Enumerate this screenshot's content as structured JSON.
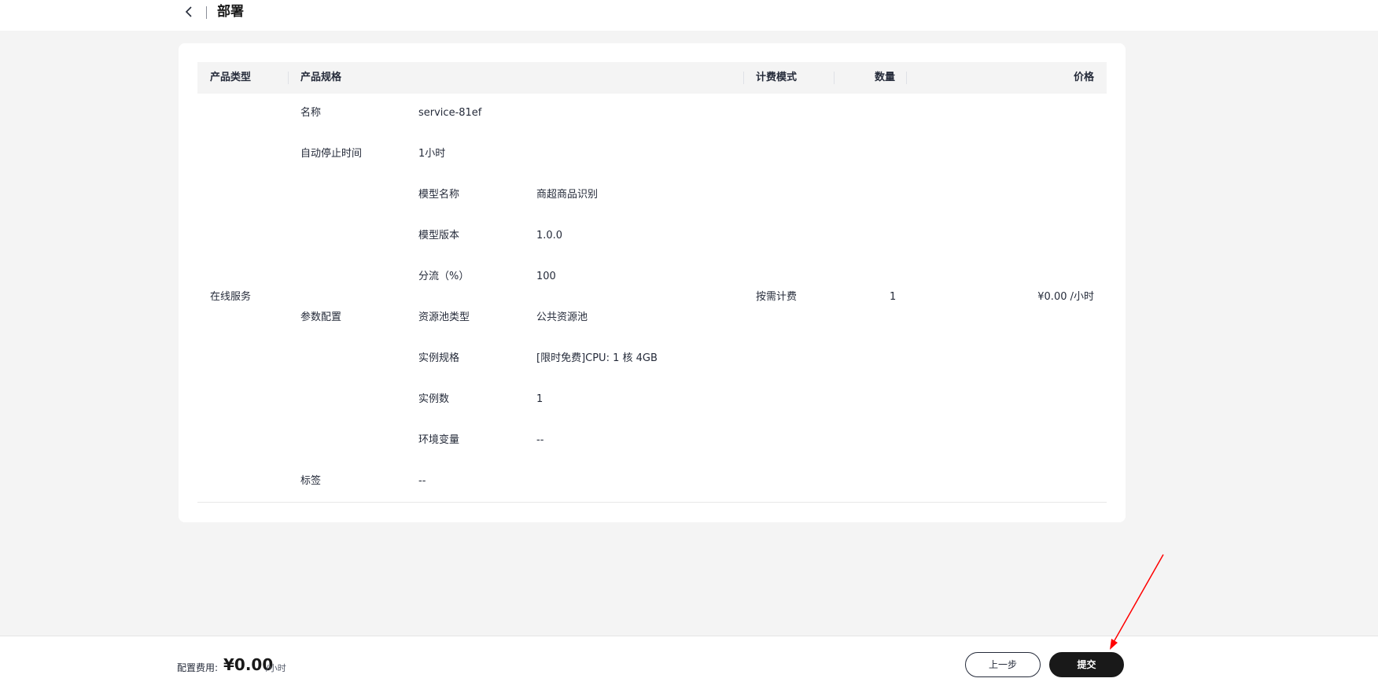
{
  "header": {
    "title": "部署"
  },
  "table": {
    "columns": [
      "产品类型",
      "产品规格",
      "计费模式",
      "数量",
      "价格"
    ],
    "product_type": "在线服务",
    "specs": [
      {
        "label": "名称",
        "value": "service-81ef"
      },
      {
        "label": "自动停止时间",
        "value": "1小时"
      },
      {
        "label": "参数配置",
        "params": [
          {
            "label": "模型名称",
            "value": "商超商品识别"
          },
          {
            "label": "模型版本",
            "value": "1.0.0"
          },
          {
            "label": "分流（%）",
            "value": "100"
          },
          {
            "label": "资源池类型",
            "value": "公共资源池"
          },
          {
            "label": "实例规格",
            "value": "[限时免费]CPU: 1 核 4GB"
          },
          {
            "label": "实例数",
            "value": "1"
          },
          {
            "label": "环境变量",
            "value": "--"
          }
        ]
      },
      {
        "label": "标签",
        "value": "--"
      }
    ],
    "billing_mode": "按需计费",
    "quantity": "1",
    "price": "¥0.00 /小时"
  },
  "footer": {
    "fee_label": "配置费用:",
    "fee_value": "¥0.00",
    "fee_unit": "/小时",
    "prev_label": "上一步",
    "submit_label": "提交"
  },
  "colors": {
    "annotation_arrow": "#ff0000",
    "primary_button": "#191919"
  }
}
